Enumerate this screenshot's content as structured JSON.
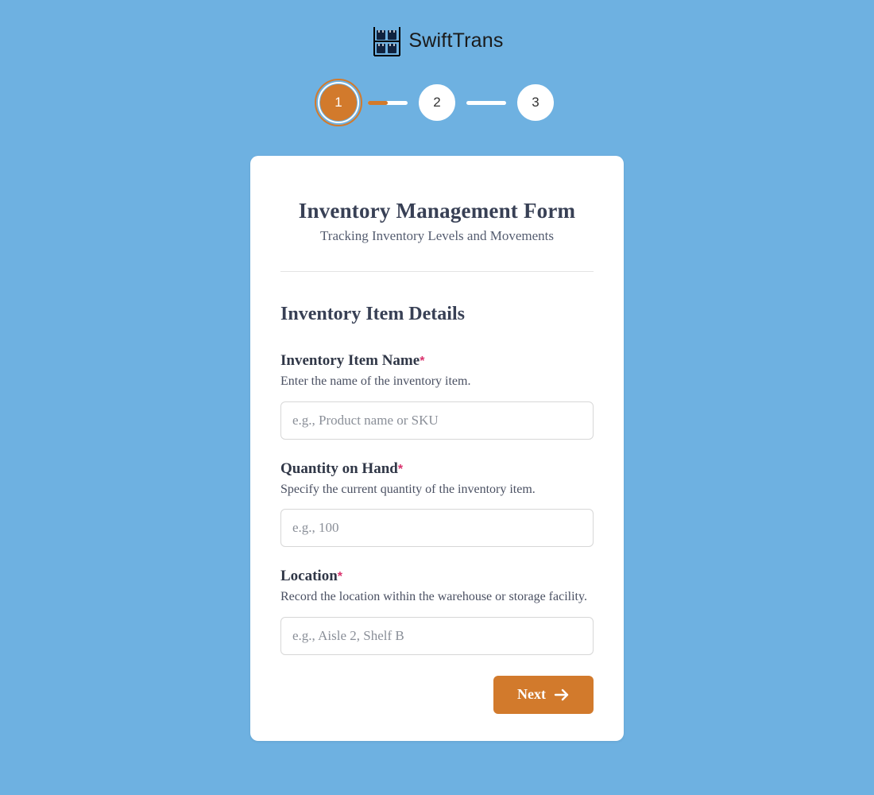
{
  "brand": {
    "name": "SwiftTrans"
  },
  "stepper": {
    "steps": [
      "1",
      "2",
      "3"
    ],
    "active_index": 0,
    "progress_between_1_and_2_percent": 50
  },
  "form": {
    "title": "Inventory Management Form",
    "subtitle": "Tracking Inventory Levels and Movements",
    "section_title": "Inventory Item Details",
    "fields": {
      "item_name": {
        "label": "Inventory Item Name",
        "required_marker": "*",
        "help": "Enter the name of the inventory item.",
        "placeholder": "e.g., Product name or SKU",
        "value": ""
      },
      "quantity": {
        "label": "Quantity on Hand",
        "required_marker": "*",
        "help": "Specify the current quantity of the inventory item.",
        "placeholder": "e.g., 100",
        "value": ""
      },
      "location": {
        "label": "Location",
        "required_marker": "*",
        "help": "Record the location within the warehouse or storage facility.",
        "placeholder": "e.g., Aisle 2, Shelf B",
        "value": ""
      }
    },
    "next_label": "Next"
  },
  "colors": {
    "accent": "#D27A2C",
    "bg": "#6EB1E1",
    "heading": "#384055",
    "required": "#d9326d"
  }
}
